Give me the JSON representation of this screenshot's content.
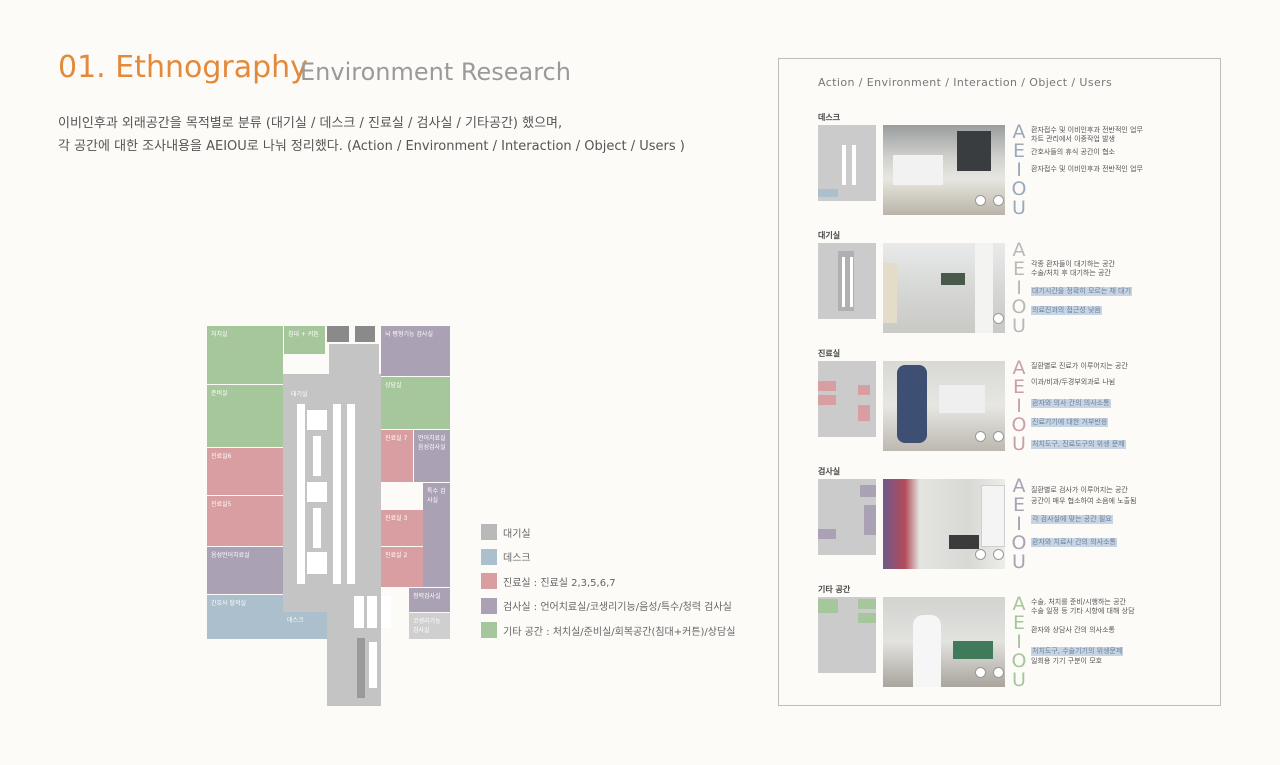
{
  "header": {
    "title": "01. Ethnography",
    "subtitle": "Environment Research",
    "description_1": "이비인후과 외래공간을 목적별로 분류 (대기실 / 데스크 / 진료실  / 검사실 / 기타공간) 했으며,",
    "description_2": "각 공간에 대한 조사내용을 AEIOU로 나눠 정리했다. (Action / Environment / Interaction / Object / Users )"
  },
  "floorplan": {
    "rooms": [
      {
        "label": "처치실"
      },
      {
        "label": "침대 + 커튼"
      },
      {
        "label": "뇌 평형기능 검사실"
      },
      {
        "label": "상담실"
      },
      {
        "label": "준비실"
      },
      {
        "label": "대기실"
      },
      {
        "label": "진료실 7"
      },
      {
        "label": "언어치료실 음성검사실"
      },
      {
        "label": "진료실6"
      },
      {
        "label": "특수 검사실"
      },
      {
        "label": "진료실5"
      },
      {
        "label": "진료실 3"
      },
      {
        "label": "진료실 2"
      },
      {
        "label": "음성언어치료실"
      },
      {
        "label": "청력검사실"
      },
      {
        "label": "간호사 탈의실"
      },
      {
        "label": "데스크"
      },
      {
        "label": "코생리기능검사실"
      }
    ]
  },
  "legend": {
    "items": [
      {
        "label": "대기실",
        "color": "#b9b9b9"
      },
      {
        "label": "데스크",
        "color": "#acbfcc"
      },
      {
        "label": "진료실 : 진료실 2,3,5,6,7",
        "color": "#d99ea2"
      },
      {
        "label": "검사실 : 언어치료실/코생리기능/음성/특수/청력 검사실",
        "color": "#aaa1b4"
      },
      {
        "label": "기타 공간 : 처치실/준비실/회복공간(침대+커튼)/상담실",
        "color": "#a6c69b"
      }
    ]
  },
  "panel": {
    "header": "Action / Environment / Interaction / Object / Users",
    "aeiou": [
      "A",
      "E",
      "I",
      "O",
      "U"
    ],
    "sections": [
      {
        "label": "데스크",
        "aeiou_color": "#9aaabb",
        "notes": [
          {
            "text": "환자접수 및 이비인후과 전반적인 업무",
            "hl": false
          },
          {
            "text": "차트 관리에서 이중작업 발생",
            "hl": false
          },
          {
            "text": "간호사들의 휴식 공간이 협소",
            "hl": false
          },
          {
            "text": "환자접수 및 이비인후과 전반적인 업무",
            "hl": false
          }
        ]
      },
      {
        "label": "대기실",
        "aeiou_color": "#b9b9b9",
        "notes": [
          {
            "text": "각종 환자들이 대기하는 공간",
            "hl": false
          },
          {
            "text": "수술/처치 후 대기하는 공간",
            "hl": false
          },
          {
            "text": "대기시간을 정확히 모르는 채 대기",
            "hl": true
          },
          {
            "text": "의료진과의 접근성 낮음",
            "hl": true
          }
        ]
      },
      {
        "label": "진료실",
        "aeiou_color": "#c9a0a6",
        "notes": [
          {
            "text": "질환별로 진료가 이루어지는 공간",
            "hl": false
          },
          {
            "text": "이과/비과/두경부외과로 나뉨",
            "hl": false
          },
          {
            "text": "환자와 의사 간의 의사소통",
            "hl": true
          },
          {
            "text": "진료기기에 대한 거부반응",
            "hl": true
          },
          {
            "text": "처치도구, 진료도구의 위생 문제",
            "hl": true
          }
        ]
      },
      {
        "label": "검사실",
        "aeiou_color": "#aaa1b4",
        "notes": [
          {
            "text": "질환별로 검사가 이루어지는 공간",
            "hl": false
          },
          {
            "text": "공간이 매우 협소하여 소음에 노출됨",
            "hl": false
          },
          {
            "text": "각 검사실에 맞는 공간 필요",
            "hl": true
          },
          {
            "text": "환자와 치료사 간의 의사소통",
            "hl": true
          }
        ]
      },
      {
        "label": "기타 공간",
        "aeiou_color": "#a6c69b",
        "notes": [
          {
            "text": "수술, 처치를 준비/시행하는 공간",
            "hl": false
          },
          {
            "text": "수술 일정 등 기타 시항에 대해 상담",
            "hl": false
          },
          {
            "text": "환자와 상담사 간의 의사소통",
            "hl": false
          },
          {
            "text": "처치도구, 수술기기의 위생문제",
            "hl": true
          },
          {
            "text": "일회용 기기 구분이 모호",
            "hl": false
          }
        ]
      }
    ]
  }
}
